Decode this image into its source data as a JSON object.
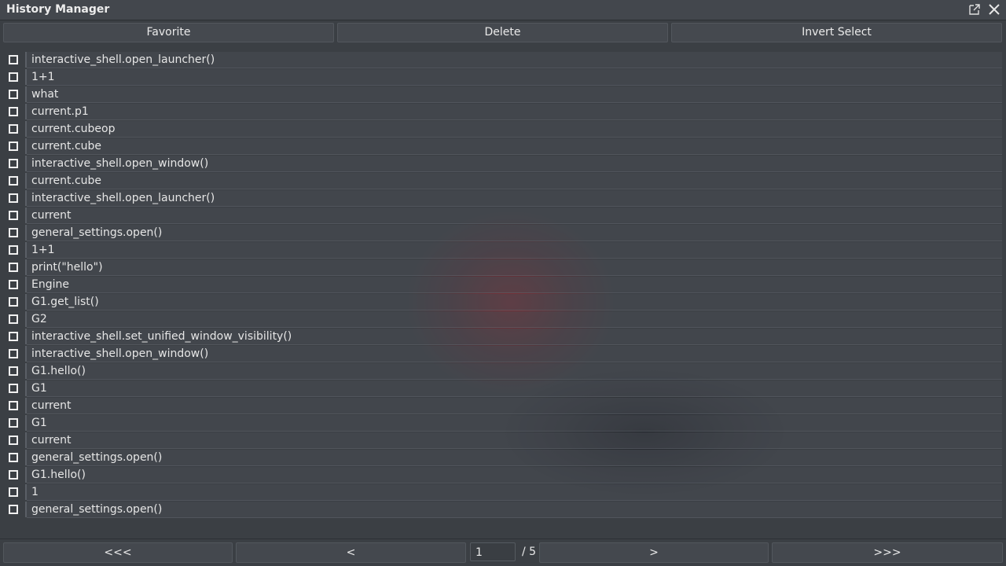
{
  "window": {
    "title": "History Manager",
    "popout_icon": "popout-icon",
    "close_icon": "close-icon"
  },
  "toolbar": {
    "favorite_label": "Favorite",
    "delete_label": "Delete",
    "invert_select_label": "Invert Select"
  },
  "history": [
    "interactive_shell.open_launcher()",
    "1+1",
    "what",
    "current.p1",
    "current.cubeop",
    "current.cube",
    "interactive_shell.open_window()",
    "current.cube",
    "interactive_shell.open_launcher()",
    "current",
    "general_settings.open()",
    "1+1",
    "print(\"hello\")",
    "Engine",
    "G1.get_list()",
    "G2",
    "interactive_shell.set_unified_window_visibility()",
    "interactive_shell.open_window()",
    "G1.hello()",
    "G1",
    "current",
    "G1",
    "current",
    "general_settings.open()",
    "G1.hello()",
    "1",
    "general_settings.open()"
  ],
  "pager": {
    "first_label": "<<<",
    "prev_label": "<",
    "current_page": "1",
    "total_label": "/ 5",
    "next_label": ">",
    "last_label": ">>>"
  },
  "colors": {
    "background": "#3b3f44",
    "text": "#e8e8e8"
  }
}
